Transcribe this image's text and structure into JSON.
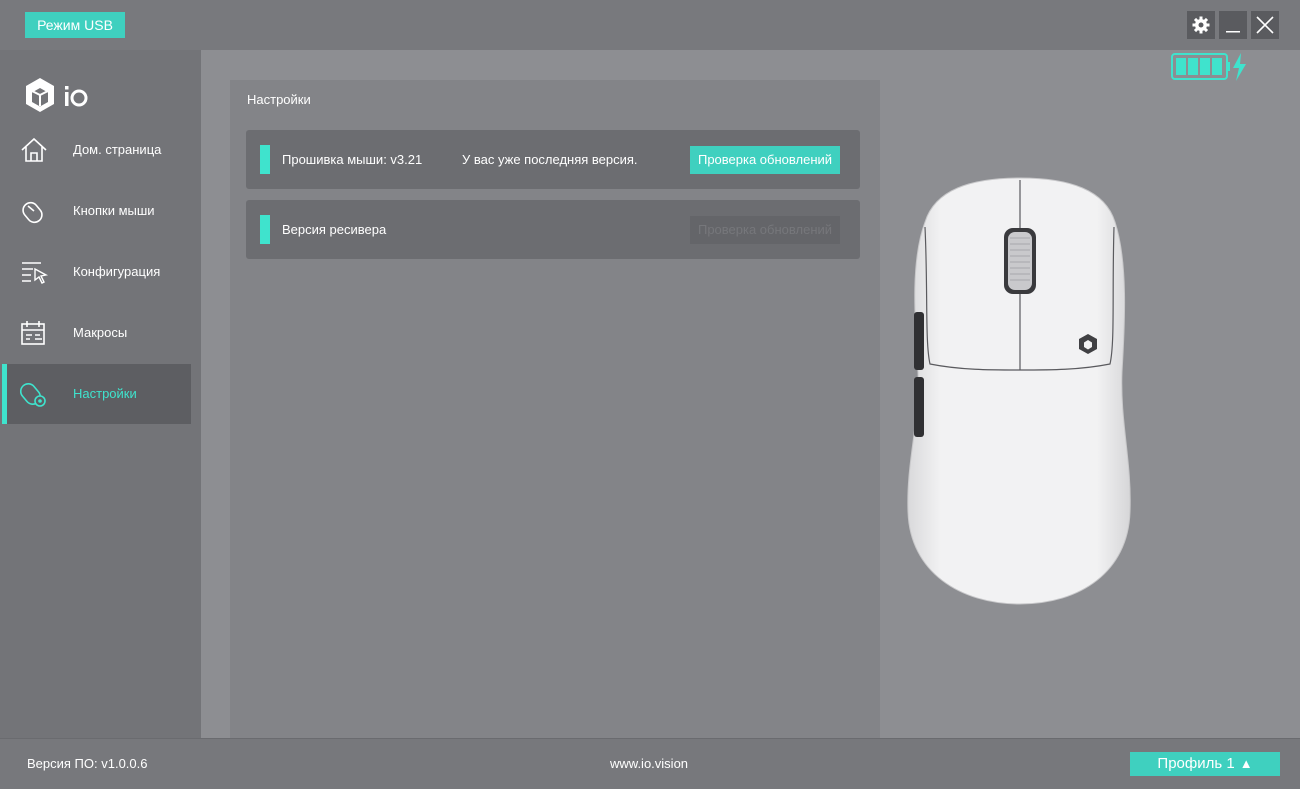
{
  "titlebar": {
    "mode_badge": "Режим USB",
    "buttons": [
      "gear-icon",
      "minimize-icon",
      "close-icon"
    ]
  },
  "sidebar": {
    "logo_text": "iO",
    "items": [
      {
        "label": "Дом. страница",
        "icon": "home-icon"
      },
      {
        "label": "Кнопки мыши",
        "icon": "mouse-icon"
      },
      {
        "label": "Конфигурация",
        "icon": "configuration-icon"
      },
      {
        "label": "Макросы",
        "icon": "macro-icon"
      },
      {
        "label": "Настройки",
        "icon": "settings-mouse-icon",
        "active": true
      }
    ]
  },
  "main": {
    "title": "Настройки",
    "firmware": {
      "label": "Прошивка мыши: v3.21",
      "status": "У вас уже последняя версия.",
      "button": "Проверка обновлений"
    },
    "receiver": {
      "label": "Версия ресивера",
      "button": "Проверка обновлений"
    }
  },
  "battery": {
    "segments_filled": 4,
    "segments_total": 4,
    "charging": true
  },
  "footer": {
    "version": "Версия ПО: v1.0.0.6",
    "website": "www.io.vision",
    "profile_button": "Профиль 1",
    "profile_arrow": "▲"
  },
  "colors": {
    "accent": "#3fe3cd",
    "button": "#3fd0bf",
    "sidebar": "#737478",
    "background": "#8d8e92"
  }
}
